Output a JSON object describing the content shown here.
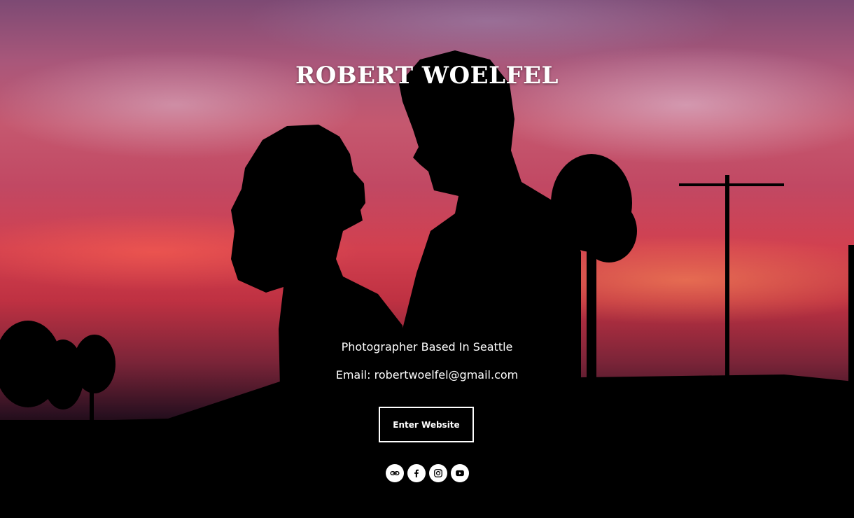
{
  "page": {
    "title": "ROBERT WOELFEL",
    "tagline": "Photographer Based In Seattle",
    "email": "Email: robertwoelfel@gmail.com",
    "enter_label": "Enter Website"
  },
  "socials": [
    {
      "icon": "link-icon"
    },
    {
      "icon": "facebook-icon"
    },
    {
      "icon": "instagram-icon"
    },
    {
      "icon": "youtube-icon"
    }
  ],
  "colors": {
    "text": "#ffffff",
    "sky_top": "#7d4a74",
    "sky_mid": "#d2404f",
    "ground": "#000000"
  }
}
